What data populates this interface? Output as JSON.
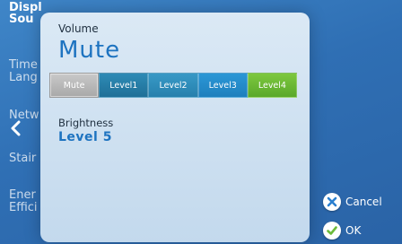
{
  "sidebar": {
    "items": [
      {
        "label": "Displ"
      },
      {
        "label": "Sou"
      },
      {
        "label": "Time"
      },
      {
        "label": "Lang"
      },
      {
        "label": "Netw"
      },
      {
        "label": "Stair"
      },
      {
        "label": "Ener"
      },
      {
        "label": "Effici"
      }
    ]
  },
  "volume": {
    "label": "Volume",
    "value": "Mute",
    "levels": [
      {
        "label": "Mute",
        "selected": true
      },
      {
        "label": "Level1"
      },
      {
        "label": "Level2"
      },
      {
        "label": "Level3"
      },
      {
        "label": "Level4"
      }
    ]
  },
  "brightness": {
    "label": "Brightness",
    "value": "Level 5"
  },
  "buttons": {
    "cancel": "Cancel",
    "ok": "OK"
  },
  "icons": {
    "back": "chevron-left-icon",
    "cancel": "close-icon",
    "ok": "check-icon"
  },
  "colors": {
    "accent": "#1d73c0",
    "cancel_icon": "#2a7fcf",
    "ok_icon": "#6cbb3a"
  }
}
